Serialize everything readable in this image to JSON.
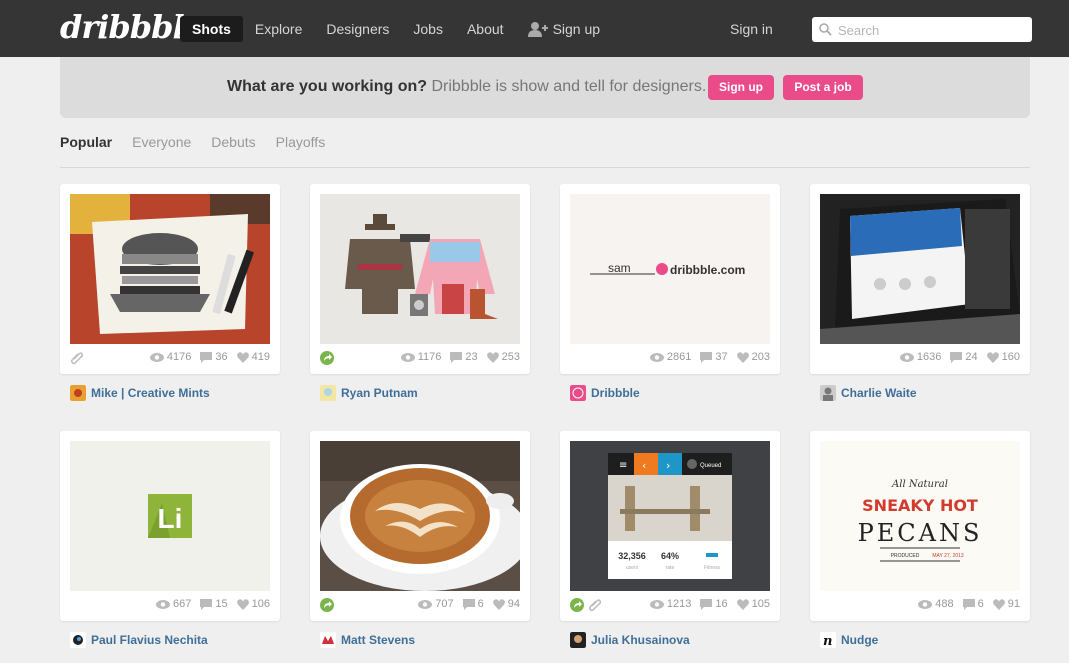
{
  "header": {
    "logo": "dribbble",
    "nav": [
      "Shots",
      "Explore",
      "Designers",
      "Jobs",
      "About",
      "Sign up"
    ],
    "signin": "Sign in",
    "search_placeholder": "Search"
  },
  "banner": {
    "question": "What are you working on?",
    "text": " Dribbble is show and tell for designers.",
    "signup": "Sign up",
    "post_job": "Post a job"
  },
  "tabs": [
    "Popular",
    "Everyone",
    "Debuts",
    "Playoffs"
  ],
  "shots": [
    {
      "views": "4176",
      "comments": "36",
      "likes": "419",
      "author": "Mike | Creative Mints",
      "attachment": true,
      "rebound": false
    },
    {
      "views": "1176",
      "comments": "23",
      "likes": "253",
      "author": "Ryan Putnam",
      "attachment": false,
      "rebound": true
    },
    {
      "views": "2861",
      "comments": "37",
      "likes": "203",
      "author": "Dribbble",
      "attachment": false,
      "rebound": false,
      "thumb_text": "sam",
      "thumb_text2": "dribbble.com"
    },
    {
      "views": "1636",
      "comments": "24",
      "likes": "160",
      "author": "Charlie Waite",
      "attachment": false,
      "rebound": false
    },
    {
      "views": "667",
      "comments": "15",
      "likes": "106",
      "author": "Paul Flavius Nechita",
      "attachment": false,
      "rebound": false,
      "thumb_text": "Li"
    },
    {
      "views": "707",
      "comments": "6",
      "likes": "94",
      "author": "Matt Stevens",
      "attachment": false,
      "rebound": true
    },
    {
      "views": "1213",
      "comments": "16",
      "likes": "105",
      "author": "Julia Khusainova",
      "attachment": true,
      "rebound": true,
      "thumb_text": "Queued",
      "thumb_num1": "32,356",
      "thumb_num2": "64%",
      "thumb_l1": "users",
      "thumb_l2": "rate",
      "thumb_l3": "Fitness"
    },
    {
      "views": "488",
      "comments": "6",
      "likes": "91",
      "author": "Nudge",
      "attachment": false,
      "rebound": false,
      "thumb_text": "All Natural",
      "thumb_text2": "SNEAKY HOT",
      "thumb_text3": "PECANS",
      "thumb_text4": "PRODUCED",
      "thumb_text5": "MAY 27, 2013"
    }
  ],
  "colors": {
    "header": "#353535",
    "accent": "#ea4c89",
    "link": "#3f6f98"
  }
}
